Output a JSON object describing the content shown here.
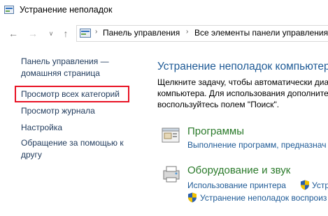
{
  "window": {
    "title": "Устранение неполадок"
  },
  "nav": {
    "breadcrumbs": [
      "Панель управления",
      "Все элементы панели управления"
    ]
  },
  "sidebar": {
    "items": [
      {
        "label_line1": "Панель управления —",
        "label_line2": "домашняя страница"
      },
      {
        "label": "Просмотр всех категорий",
        "highlighted": true
      },
      {
        "label": "Просмотр журнала"
      },
      {
        "label": "Настройка"
      },
      {
        "label_line1": "Обращение за помощью к",
        "label_line2": "другу"
      }
    ],
    "highlight_color": "#e81123"
  },
  "main": {
    "title": "Устранение неполадок компьютера",
    "description": [
      "Щелкните задачу, чтобы автоматически диа",
      "компьютера. Для использования дополните",
      "воспользуйтесь полем \"Поиск\"."
    ],
    "categories": [
      {
        "title": "Программы",
        "links": [
          "Выполнение программ, предназнач"
        ]
      },
      {
        "title": "Оборудование и звук",
        "links": [
          "Использование принтера",
          "Устр",
          "Устранение неполадок воспроиз"
        ]
      }
    ],
    "link_color": "#1e5a96",
    "category_color": "#2a7a2a"
  }
}
